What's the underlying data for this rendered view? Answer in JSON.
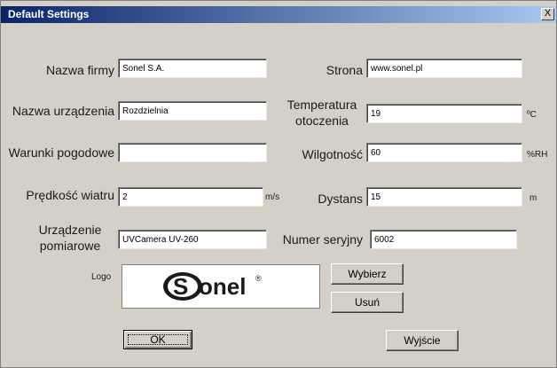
{
  "window": {
    "title": "Default Settings",
    "close_glyph": "X"
  },
  "form": {
    "company": {
      "label": "Nazwa firmy",
      "value": "Sonel S.A."
    },
    "website": {
      "label": "Strona",
      "value": "www.sonel.pl"
    },
    "device": {
      "label": "Nazwa urządzenia",
      "value": "Rozdzielnia"
    },
    "temperature": {
      "label_line1": "Temperatura",
      "label_line2": "otoczenia",
      "value": "19",
      "unit": "ºC"
    },
    "weather": {
      "label": "Warunki pogodowe",
      "value": ""
    },
    "humidity": {
      "label": "Wilgotność",
      "value": "60",
      "unit": "%RH"
    },
    "wind": {
      "label": "Prędkość wiatru",
      "value": "2",
      "unit": "m/s"
    },
    "distance": {
      "label": "Dystans",
      "value": "15",
      "unit": "m"
    },
    "instrument": {
      "label_line1": "Urządzenie",
      "label_line2": "pomiarowe",
      "value": "UVCamera UV-260"
    },
    "serial": {
      "label": "Numer seryjny",
      "value": "6002"
    }
  },
  "logo": {
    "label": "Logo",
    "brand_text": "onel",
    "brand_initial": "S",
    "registered": "®"
  },
  "buttons": {
    "choose": "Wybierz",
    "remove": "Usuń",
    "ok": "OK",
    "exit": "Wyjście"
  },
  "colors": {
    "titlebar_start": "#0a246a",
    "titlebar_end": "#a6caf0",
    "dialog_bg": "#d4d0c8"
  }
}
